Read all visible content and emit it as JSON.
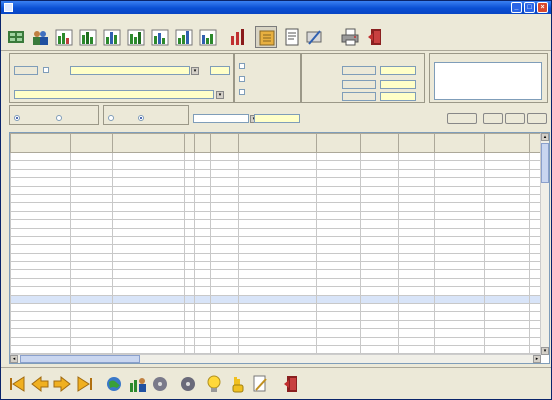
{
  "window": {
    "title": ""
  },
  "menu": [],
  "toolbar": {
    "buttons": [
      {
        "name": "grid-icon"
      },
      {
        "name": "people-icon"
      },
      {
        "name": "chart-icon"
      },
      {
        "name": "chart-green-icon"
      },
      {
        "name": "chart-blue-icon"
      },
      {
        "name": "chart-icon"
      },
      {
        "name": "chart-green-icon"
      },
      {
        "name": "chart-blue-icon"
      },
      {
        "name": "bar-chart-icon"
      },
      {
        "name": "notebook-icon"
      },
      {
        "name": "document-icon"
      },
      {
        "name": "edit-icon"
      },
      {
        "name": "printer-icon"
      },
      {
        "name": "exit-icon"
      }
    ]
  },
  "form": {
    "code_value": "",
    "client_value": "",
    "supplier_value": "",
    "totals_values": [
      "",
      "",
      "",
      "",
      "",
      ""
    ]
  },
  "grid": {
    "columns": [
      "",
      "",
      "",
      "",
      "",
      "",
      "",
      "",
      "",
      "",
      "",
      "",
      ""
    ],
    "rows": [
      [
        "",
        "",
        "",
        "",
        "",
        "",
        "",
        "",
        "",
        "",
        "",
        "",
        ""
      ],
      [
        "",
        "",
        "",
        "",
        "",
        "",
        "",
        "",
        "",
        "",
        "",
        "",
        ""
      ],
      [
        "",
        "",
        "",
        "",
        "",
        "",
        "",
        "",
        "",
        "",
        "",
        "",
        ""
      ],
      [
        "",
        "",
        "",
        "",
        "",
        "",
        "",
        "",
        "",
        "",
        "",
        "",
        ""
      ],
      [
        "",
        "",
        "",
        "",
        "",
        "",
        "",
        "",
        "",
        "",
        "",
        "",
        ""
      ],
      [
        "",
        "",
        "",
        "",
        "",
        "",
        "",
        "",
        "",
        "",
        "",
        "",
        ""
      ],
      [
        "",
        "",
        "",
        "",
        "",
        "",
        "",
        "",
        "",
        "",
        "",
        "",
        ""
      ],
      [
        "",
        "",
        "",
        "",
        "",
        "",
        "",
        "",
        "",
        "",
        "",
        "",
        ""
      ],
      [
        "",
        "",
        "",
        "",
        "",
        "",
        "",
        "",
        "",
        "",
        "",
        "",
        ""
      ],
      [
        "",
        "",
        "",
        "",
        "",
        "",
        "",
        "",
        "",
        "",
        "",
        "",
        ""
      ],
      [
        "",
        "",
        "",
        "",
        "",
        "",
        "",
        "",
        "",
        "",
        "",
        "",
        ""
      ],
      [
        "",
        "",
        "",
        "",
        "",
        "",
        "",
        "",
        "",
        "",
        "",
        "",
        ""
      ],
      [
        "",
        "",
        "",
        "",
        "",
        "",
        "",
        "",
        "",
        "",
        "",
        "",
        ""
      ],
      [
        "",
        "",
        "",
        "",
        "",
        "",
        "",
        "",
        "",
        "",
        "",
        "",
        ""
      ],
      [
        "",
        "",
        "",
        "",
        "",
        "",
        "",
        "",
        "",
        "",
        "",
        "",
        ""
      ],
      [
        "",
        "",
        "",
        "",
        "",
        "",
        "",
        "",
        "",
        "",
        "",
        "",
        ""
      ],
      [
        "",
        "",
        "",
        "",
        "",
        "",
        "",
        "",
        "",
        "",
        "",
        "",
        ""
      ],
      [
        "",
        "",
        "",
        "",
        "",
        "",
        "",
        "",
        "",
        "",
        "",
        "",
        ""
      ],
      [
        "",
        "",
        "",
        "",
        "",
        "",
        "",
        "",
        "",
        "",
        "",
        "",
        ""
      ],
      [
        "",
        "",
        "",
        "",
        "",
        "",
        "",
        "",
        "",
        "",
        "",
        "",
        ""
      ],
      [
        "",
        "",
        "",
        "",
        "",
        "",
        "",
        "",
        "",
        "",
        "",
        "",
        ""
      ],
      [
        "",
        "",
        "",
        "",
        "",
        "",
        "",
        "",
        "",
        "",
        "",
        "",
        ""
      ],
      [
        "",
        "",
        "",
        "",
        "",
        "",
        "",
        "",
        "",
        "",
        "",
        "",
        ""
      ],
      [
        "",
        "",
        "",
        "",
        "",
        "",
        "",
        "",
        "",
        "",
        "",
        "",
        ""
      ]
    ],
    "selected_row": 17
  },
  "bottombar": {
    "buttons": [
      {
        "name": "first-record-icon"
      },
      {
        "name": "previous-record-icon"
      },
      {
        "name": "next-record-icon"
      },
      {
        "name": "last-record-icon"
      },
      {
        "name": "globe-icon"
      },
      {
        "name": "chart-people-icon"
      },
      {
        "name": "disk-icon"
      },
      {
        "name": "lightbulb-icon"
      },
      {
        "name": "hand-icon"
      },
      {
        "name": "document-edit-icon"
      },
      {
        "name": "exit-icon"
      }
    ]
  },
  "colors": {
    "titlebar": "#0a4fd4",
    "form_bg": "#ece9d8",
    "highlight_field": "#ffffc8",
    "selected_row": "#d8e4f8"
  }
}
